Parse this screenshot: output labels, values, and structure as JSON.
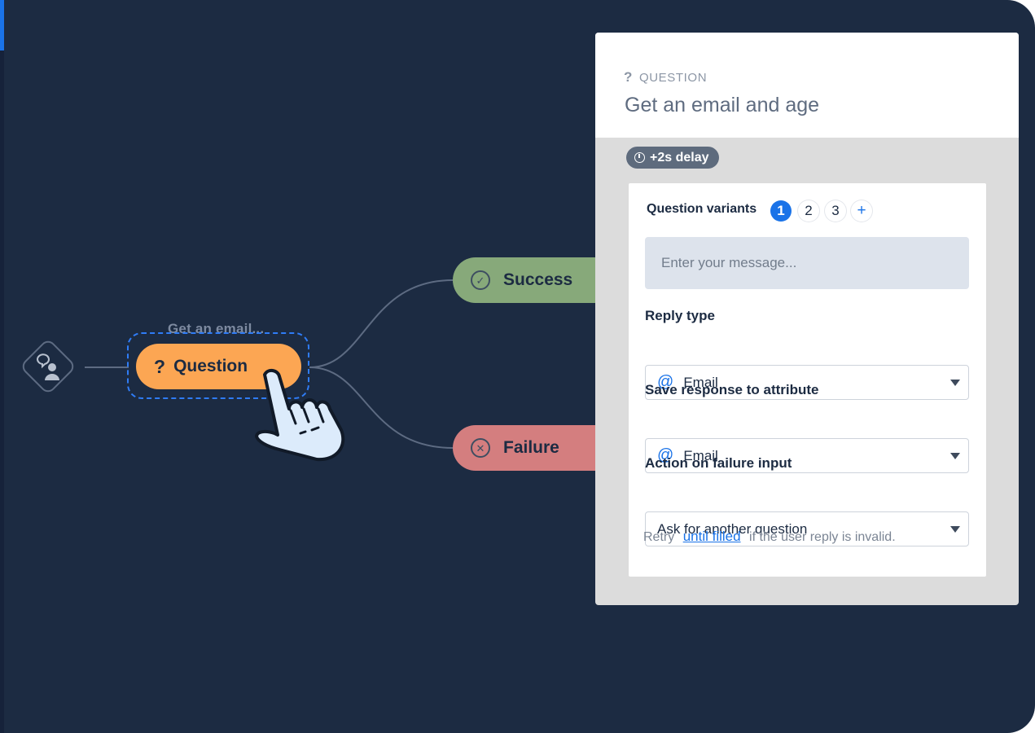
{
  "canvas": {
    "start_node": {
      "icon": "chat-user-icon"
    },
    "question_node": {
      "caption": "Get an email...",
      "label": "Question",
      "icon": "question-mark-icon"
    },
    "outcomes": {
      "success": {
        "label": "Success",
        "icon": "check-circle-icon",
        "color": "#87a97a"
      },
      "failure": {
        "label": "Failure",
        "icon": "x-circle-icon",
        "color": "#d47e7f"
      }
    },
    "cursor": {
      "icon": "pointing-hand-cursor-icon"
    }
  },
  "panel": {
    "type_label": "QUESTION",
    "type_icon": "?",
    "title": "Get an email and age",
    "delay": "+2s delay",
    "variants": {
      "label": "Question variants",
      "items": [
        "1",
        "2",
        "3"
      ],
      "active": "1",
      "add": "+"
    },
    "message": {
      "placeholder": "Enter your message..."
    },
    "reply_type": {
      "label": "Reply type",
      "value": "Email",
      "icon": "at-icon"
    },
    "save_response": {
      "label": "Save response to attribute",
      "value": "Email",
      "icon": "at-icon"
    },
    "failure_action": {
      "label": "Action on failure input",
      "value": "Ask for another question"
    },
    "retry": {
      "prefix": "Retry",
      "link": "until filled",
      "suffix": "if the user reply is invalid."
    }
  },
  "colors": {
    "canvas_bg": "#1c2b42",
    "accent": "#1a73e8",
    "question_node": "#fca653"
  }
}
